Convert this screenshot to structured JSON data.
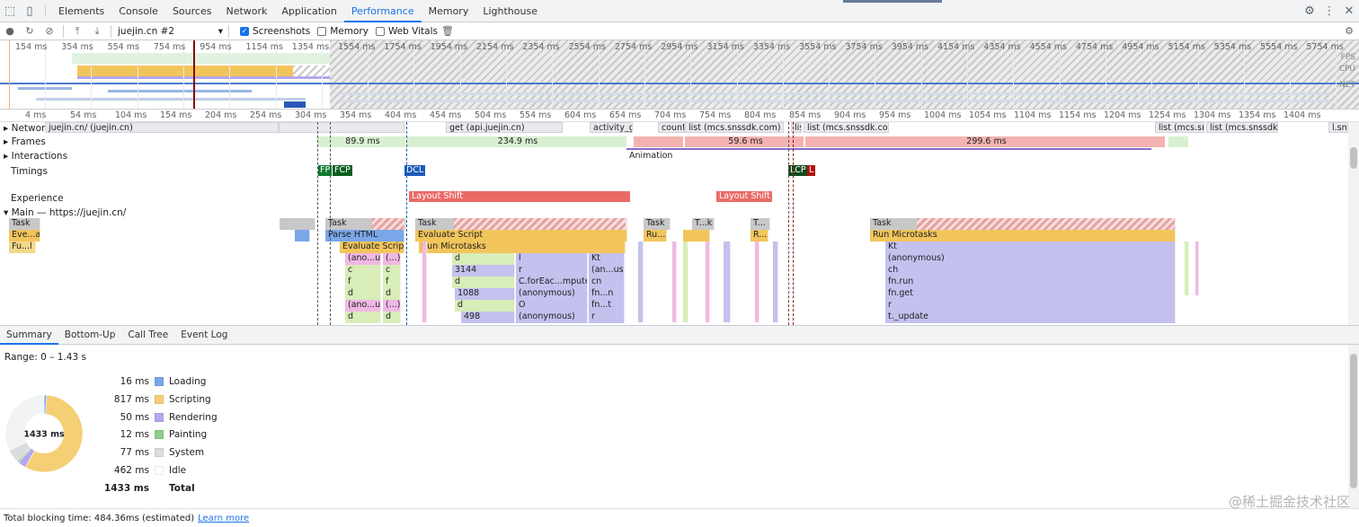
{
  "tabs": [
    "Elements",
    "Console",
    "Sources",
    "Network",
    "Application",
    "Performance",
    "Memory",
    "Lighthouse"
  ],
  "toolbar": {
    "profile": "juejin.cn #2",
    "screenshots": "Screenshots",
    "memory": "Memory",
    "web_vitals": "Web Vitals"
  },
  "overview": {
    "ticks": [
      "154 ms",
      "354 ms",
      "554 ms",
      "754 ms",
      "954 ms",
      "1154 ms",
      "1354 ms",
      "1554 ms",
      "1754 ms",
      "1954 ms",
      "2154 ms",
      "2354 ms",
      "2554 ms",
      "2754 ms",
      "2954 ms",
      "3154 ms",
      "3354 ms",
      "3554 ms",
      "3754 ms",
      "3954 ms",
      "4154 ms",
      "4354 ms",
      "4554 ms",
      "4754 ms",
      "4954 ms",
      "5154 ms",
      "5354 ms",
      "5554 ms",
      "5754 ms"
    ],
    "labels": {
      "fps": "FPS",
      "cpu": "CPU",
      "net": "NET"
    }
  },
  "ruler": [
    "4 ms",
    "54 ms",
    "104 ms",
    "154 ms",
    "204 ms",
    "254 ms",
    "304 ms",
    "354 ms",
    "404 ms",
    "454 ms",
    "504 ms",
    "554 ms",
    "604 ms",
    "654 ms",
    "704 ms",
    "754 ms",
    "804 ms",
    "854 ms",
    "904 ms",
    "954 ms",
    "1004 ms",
    "1054 ms",
    "1104 ms",
    "1154 ms",
    "1204 ms",
    "1254 ms",
    "1304 ms",
    "1354 ms",
    "1404 ms"
  ],
  "tracks": {
    "network": "Network",
    "frames": "Frames",
    "interactions": "Interactions",
    "timings": "Timings",
    "experience": "Experience",
    "main": "Main — https://juejin.cn/"
  },
  "network_items": {
    "n1": "juejin.cn/ (juejin.cn)",
    "n2": "get (api.juejin.cn)",
    "n3": "activity_get",
    "n4": "count",
    "n5": "list (mcs.snssdk.com)",
    "n6": "list (mcs.snssdk.com)",
    "n7": "list",
    "n8": "list (mcs.snssdk.com)",
    "n9": "list (mcs.snssdk.co...",
    "n10": "list (mcs.snssdk.co...",
    "n11": "l.sns..."
  },
  "frames": {
    "f1": "89.9 ms",
    "f2": "234.9 ms",
    "f3": "59.6 ms",
    "f4": "299.6 ms"
  },
  "interactions": {
    "animation": "Animation"
  },
  "timings": {
    "fp": "FP",
    "fcp": "FCP",
    "dcl": "DCL",
    "lcp": "LCP",
    "l": "L"
  },
  "experience": {
    "ls1": "Layout Shift",
    "ls2": "Layout Shift"
  },
  "flame": {
    "task": "Task",
    "t1": "Task",
    "t2": "Task",
    "t3": "Task",
    "t4": "T...k",
    "t5": "T...",
    "t6": "Task",
    "evad": "Eve...ad",
    "fu": "Fu...l",
    "parse": "Parse HTML",
    "evalscript": "Evaluate Script",
    "evalscript2": "Evaluate Script",
    "runmicro": "Run Microtasks",
    "rus": "Ru...s",
    "rdot": "R...",
    "runmicro2": "Run Microtasks",
    "anous1": "(ano...us)",
    "paren": "(...)",
    "c1": "c",
    "c2": "c",
    "f1": "f",
    "f2": "f",
    "d1": "d",
    "d2": "d",
    "anous2": "(ano...us)",
    "paren2": "(...)",
    "d3": "d",
    "d4": "d",
    "d5": "d",
    "n3144": "3144",
    "d6": "d",
    "n1088": "1088",
    "d7": "d",
    "n498": "498",
    "l": "l",
    "r": "r",
    "cfor": "C.forEac...mputed>",
    "anon": "(anonymous)",
    "o": "O",
    "anon2": "(anonymous)",
    "kt": "Kt",
    "anus": "(an...us)",
    "cn": "cn",
    "fnn": "fn...n",
    "fnt": "fn...t",
    "r2": "r",
    "kt2": "Kt",
    "anon3": "(anonymous)",
    "ch": "ch",
    "fnrun": "fn.run",
    "fnget": "fn.get",
    "r3": "r",
    "tupdate": "t._update"
  },
  "bottom_tabs": [
    "Summary",
    "Bottom-Up",
    "Call Tree",
    "Event Log"
  ],
  "summary": {
    "range": "Range: 0 – 1.43 s",
    "center": "1433 ms",
    "rows": [
      {
        "value": "16 ms",
        "name": "Loading",
        "color": "#7aa7e8"
      },
      {
        "value": "817 ms",
        "name": "Scripting",
        "color": "#f5cf75"
      },
      {
        "value": "50 ms",
        "name": "Rendering",
        "color": "#b6a6ec"
      },
      {
        "value": "12 ms",
        "name": "Painting",
        "color": "#8fcf8a"
      },
      {
        "value": "77 ms",
        "name": "System",
        "color": "#dadce0"
      },
      {
        "value": "462 ms",
        "name": "Idle",
        "color": "#ffffff"
      }
    ],
    "total_value": "1433 ms",
    "total_name": "Total"
  },
  "status": {
    "text": "Total blocking time: 484.36ms (estimated)",
    "link": "Learn more"
  },
  "watermark": "@稀土掘金技术社区"
}
